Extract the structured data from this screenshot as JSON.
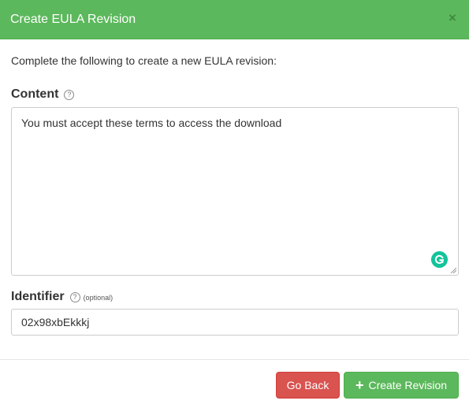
{
  "dialog": {
    "title": "Create EULA Revision",
    "close_glyph": "×",
    "intro": "Complete the following to create a new EULA revision:"
  },
  "content_field": {
    "label": "Content",
    "help_glyph": "?",
    "value": "You must accept these terms to access the download"
  },
  "identifier_field": {
    "label": "Identifier",
    "help_glyph": "?",
    "optional_note": "(optional)",
    "value": "02x98xbEkkkj"
  },
  "footer": {
    "back_label": "Go Back",
    "create_label": "Create Revision",
    "create_icon": "+"
  },
  "colors": {
    "header": "#5cb85c",
    "danger": "#d9534f",
    "success": "#5cb85c",
    "grammarly": "#15c39a"
  },
  "icons": [
    "close-icon",
    "help-icon",
    "grammarly-icon",
    "resize-handle-icon",
    "plus-icon"
  ]
}
